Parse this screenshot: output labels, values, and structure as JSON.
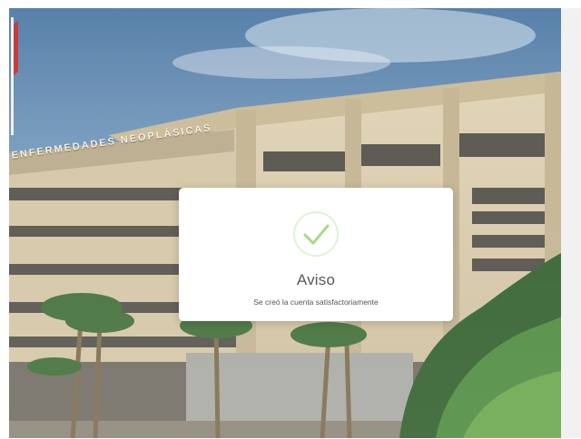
{
  "background": {
    "building_sign": "ENFERMEDADES NEOPLÁSICAS",
    "sky_color": "#5f86ad",
    "building_color": "#d8c9a8"
  },
  "dialog": {
    "icon": "check-icon",
    "title": "Aviso",
    "message": "Se creó la cuenta satisfactoriamente",
    "accent_color": "#a5dc86"
  }
}
